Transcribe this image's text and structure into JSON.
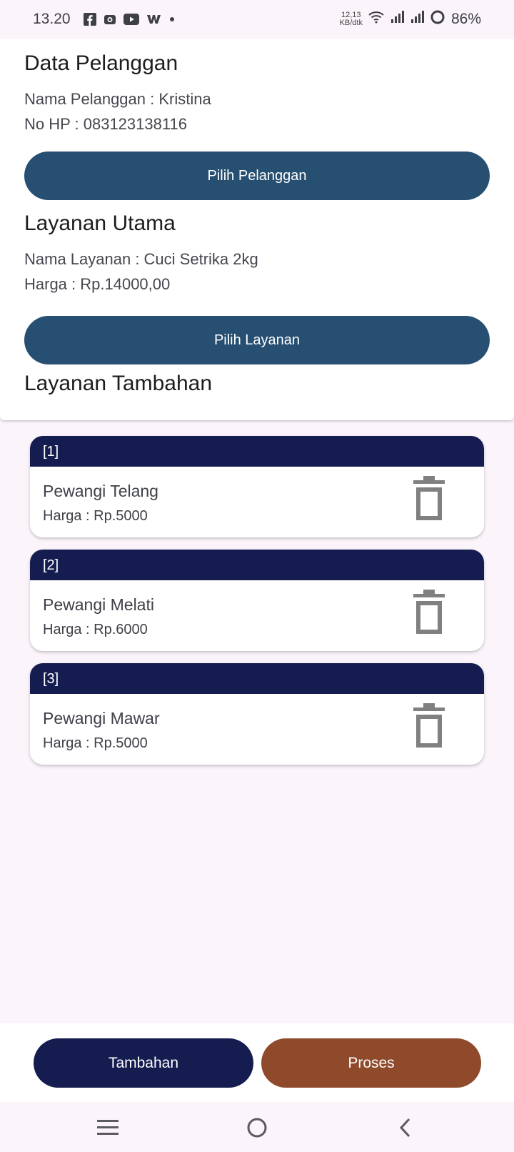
{
  "status_bar": {
    "time": "13.20",
    "speed_value": "12,13",
    "speed_unit": "KB/dtk",
    "battery": "86%",
    "notification_icons": [
      "facebook-icon",
      "photos-icon",
      "youtube-icon",
      "webtoon-icon",
      "dot-icon"
    ]
  },
  "customer": {
    "title": "Data Pelanggan",
    "name_line": "Nama Pelanggan : Kristina",
    "phone_line": "No HP : 083123138116",
    "button_label": "Pilih Pelanggan"
  },
  "main_service": {
    "title": "Layanan Utama",
    "name_line": "Nama Layanan : Cuci Setrika 2kg",
    "price_line": "Harga : Rp.14000,00",
    "button_label": "Pilih Layanan"
  },
  "extra_services": {
    "title": "Layanan Tambahan",
    "items": [
      {
        "index": "[1]",
        "name": "Pewangi Telang",
        "price": "Harga : Rp.5000"
      },
      {
        "index": "[2]",
        "name": "Pewangi Melati",
        "price": "Harga : Rp.6000"
      },
      {
        "index": "[3]",
        "name": "Pewangi Mawar",
        "price": "Harga : Rp.5000"
      }
    ]
  },
  "actions": {
    "add_label": "Tambahan",
    "process_label": "Proses"
  },
  "colors": {
    "primary_button": "#264f72",
    "card_header": "#141c50",
    "add_button": "#141c50",
    "process_button": "#8f4a2c",
    "background": "#fbf5fb"
  }
}
